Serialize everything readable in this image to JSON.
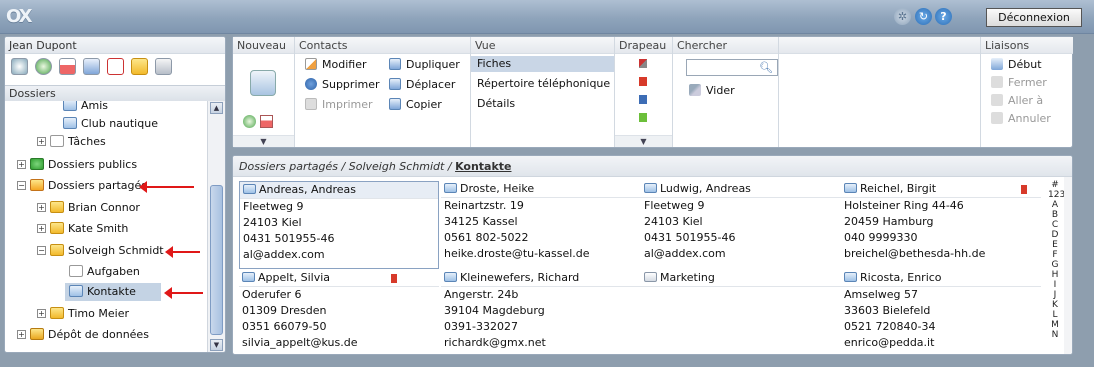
{
  "topbar": {
    "logo": "OX",
    "logout_label": "Déconnexion"
  },
  "left": {
    "user_name": "Jean Dupont",
    "dossiers_label": "Dossiers",
    "tree": [
      {
        "label": "Amis",
        "level": 2,
        "icon": "card"
      },
      {
        "label": "Club nautique",
        "level": 2,
        "icon": "card"
      },
      {
        "label": "Tâches",
        "level": 1,
        "icon": "task",
        "exp": "+"
      },
      {
        "label": "Dossiers publics",
        "level": 0,
        "icon": "public",
        "exp": "+"
      },
      {
        "label": "Dossiers partagés",
        "level": 0,
        "icon": "shared",
        "exp": "-"
      },
      {
        "label": "Brian Connor",
        "level": 1,
        "icon": "folder",
        "exp": "+"
      },
      {
        "label": "Kate Smith",
        "level": 1,
        "icon": "folder",
        "exp": "+"
      },
      {
        "label": "Solveigh Schmidt",
        "level": 1,
        "icon": "folder",
        "exp": "-"
      },
      {
        "label": "Aufgaben",
        "level": 2,
        "icon": "task"
      },
      {
        "label": "Kontakte",
        "level": 2,
        "icon": "card",
        "selected": true
      },
      {
        "label": "Timo Meier",
        "level": 1,
        "icon": "folder",
        "exp": "+"
      },
      {
        "label": "Dépôt de données",
        "level": 0,
        "icon": "depot",
        "exp": "+"
      }
    ]
  },
  "toolbar": {
    "groups": {
      "nouveau": "Nouveau",
      "contacts": "Contacts",
      "vue": "Vue",
      "drapeau": "Drapeau",
      "chercher": "Chercher",
      "liaisons": "Liaisons"
    },
    "contacts_items": {
      "modifier": "Modifier",
      "supprimer": "Supprimer",
      "imprimer": "Imprimer",
      "dupliquer": "Dupliquer",
      "deplacer": "Déplacer",
      "copier": "Copier"
    },
    "vue_items": {
      "fiches": "Fiches",
      "repertoire": "Répertoire téléphonique",
      "details": "Détails"
    },
    "search": {
      "value": "",
      "clear_label": "Vider"
    },
    "liaisons_items": {
      "debut": "Début",
      "fermer": "Fermer",
      "aller": "Aller à",
      "annuler": "Annuler"
    }
  },
  "main": {
    "crumb_a": "Dossiers partagés",
    "crumb_sep1": " / ",
    "crumb_b": "Solveigh Schmidt",
    "crumb_sep2": " / ",
    "crumb_c": "Kontakte",
    "contacts": [
      {
        "name": "Andreas, Andreas",
        "lines": [
          "Fleetweg 9",
          "24103 Kiel",
          "0431 501955-46",
          "al@addex.com"
        ],
        "selected": true
      },
      {
        "name": "Droste, Heike",
        "lines": [
          "Reinartzstr. 19",
          "34125 Kassel",
          "0561 802-5022",
          "heike.droste@tu-kassel.de"
        ]
      },
      {
        "name": "Ludwig, Andreas",
        "lines": [
          "Fleetweg 9",
          "24103 Kiel",
          "0431 501955-46",
          "al@addex.com"
        ]
      },
      {
        "name": "Reichel, Birgit",
        "lines": [
          "Holsteiner Ring 44-46",
          "20459 Hamburg",
          "040 9999330",
          "breichel@bethesda-hh.de"
        ],
        "flag": true
      },
      {
        "name": "Appelt, Silvia",
        "lines": [
          "Oderufer 6",
          "01309 Dresden",
          "0351 66079-50",
          "silvia_appelt@kus.de"
        ],
        "flag": true
      },
      {
        "name": "Kleinewefers, Richard",
        "lines": [
          "Angerstr. 24b",
          "39104 Magdeburg",
          "0391-332027",
          "richardk@gmx.net"
        ]
      },
      {
        "name": "Marketing",
        "lines": [],
        "group": true
      },
      {
        "name": "Ricosta, Enrico",
        "lines": [
          "Amselweg 57",
          "33603 Bielefeld",
          "0521 720840-34",
          "enrico@pedda.it"
        ]
      }
    ],
    "alphabet": [
      "#",
      "123",
      "A",
      "B",
      "C",
      "D",
      "E",
      "F",
      "G",
      "H",
      "I",
      "J",
      "K",
      "L",
      "M",
      "N"
    ]
  }
}
